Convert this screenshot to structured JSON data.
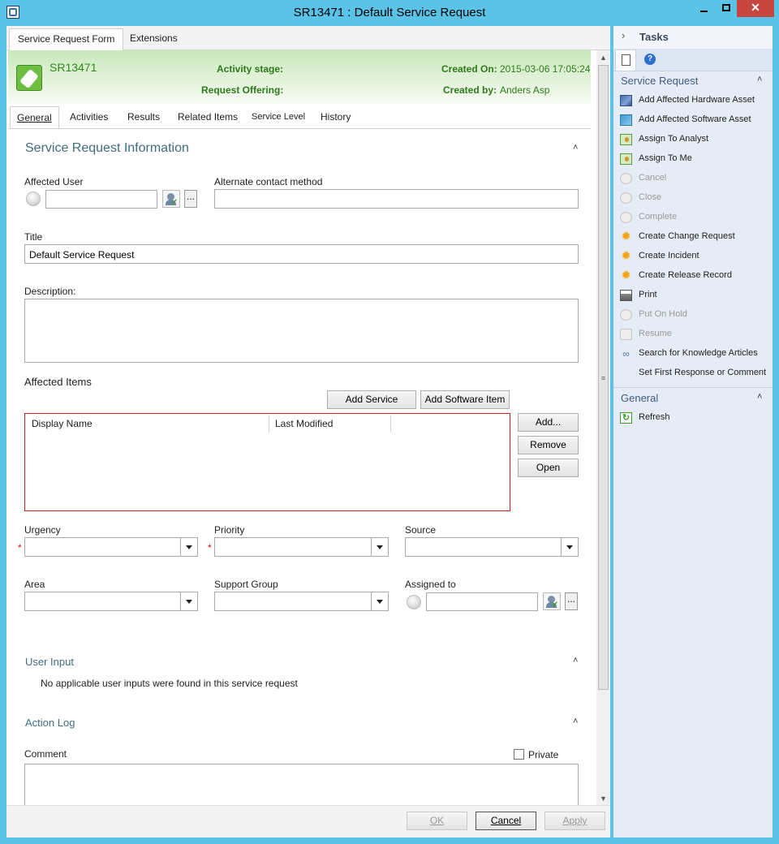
{
  "window": {
    "title": "SR13471 : Default Service Request",
    "close_glyph": "✕"
  },
  "form_tabs": [
    "Service Request Form",
    "Extensions"
  ],
  "header": {
    "id": "SR13471",
    "activity_stage_label": "Activity stage:",
    "activity_stage_value": "",
    "request_offering_label": "Request Offering:",
    "request_offering_value": "",
    "created_on_label": "Created On:",
    "created_on_value": "2015-03-06 17:05:24",
    "created_by_label": "Created by:",
    "created_by_value": "Anders Asp"
  },
  "content_tabs": [
    "General",
    "Activities",
    "Results",
    "Related Items",
    "Service Level",
    "History"
  ],
  "service_request_info": {
    "title": "Service Request Information",
    "affected_user_label": "Affected User",
    "affected_user_value": "",
    "browse_label": "...",
    "alt_contact_label": "Alternate contact method",
    "alt_contact_value": "",
    "title_label": "Title",
    "title_value": "Default Service Request",
    "description_label": "Description:",
    "description_value": ""
  },
  "affected_items": {
    "title": "Affected Items",
    "add_service_label": "Add Service",
    "add_software_label": "Add Software Item",
    "columns": [
      "Display Name",
      "Last Modified"
    ],
    "rows": [],
    "add_label": "Add...",
    "remove_label": "Remove",
    "open_label": "Open"
  },
  "fields": {
    "urgency_label": "Urgency",
    "urgency_value": "",
    "priority_label": "Priority",
    "priority_value": "",
    "source_label": "Source",
    "source_value": "",
    "area_label": "Area",
    "area_value": "",
    "support_group_label": "Support Group",
    "support_group_value": "",
    "assigned_to_label": "Assigned to",
    "assigned_to_value": "",
    "browse_label": "...",
    "required_marker": "*"
  },
  "user_input": {
    "title": "User Input",
    "message": "No applicable user inputs were found in this service request"
  },
  "action_log": {
    "title": "Action Log",
    "comment_label": "Comment",
    "comment_value": "",
    "private_label": "Private",
    "private_checked": false
  },
  "footer": {
    "ok_label": "OK",
    "cancel_label": "Cancel",
    "apply_label": "Apply"
  },
  "tasks": {
    "title": "Tasks",
    "groups": [
      {
        "name": "Service Request",
        "items": [
          {
            "label": "Add Affected Hardware Asset",
            "icon": "hardware-icon",
            "enabled": true
          },
          {
            "label": "Add Affected Software Asset",
            "icon": "software-icon",
            "enabled": true
          },
          {
            "label": "Assign To Analyst",
            "icon": "assign-icon",
            "enabled": true
          },
          {
            "label": "Assign To Me",
            "icon": "assign-icon",
            "enabled": true
          },
          {
            "label": "Cancel",
            "icon": "cancel-icon",
            "enabled": false
          },
          {
            "label": "Close",
            "icon": "close-icon",
            "enabled": false
          },
          {
            "label": "Complete",
            "icon": "complete-icon",
            "enabled": false
          },
          {
            "label": "Create Change Request",
            "icon": "star-icon",
            "enabled": true
          },
          {
            "label": "Create Incident",
            "icon": "star-icon",
            "enabled": true
          },
          {
            "label": "Create Release Record",
            "icon": "star-icon",
            "enabled": true
          },
          {
            "label": "Print",
            "icon": "printer-icon",
            "enabled": true
          },
          {
            "label": "Put On Hold",
            "icon": "hold-icon",
            "enabled": false
          },
          {
            "label": "Resume",
            "icon": "resume-icon",
            "enabled": false
          },
          {
            "label": "Search for Knowledge Articles",
            "icon": "search-icon",
            "enabled": true
          },
          {
            "label": "Set First Response or Comment",
            "icon": "",
            "enabled": true
          }
        ]
      },
      {
        "name": "General",
        "items": [
          {
            "label": "Refresh",
            "icon": "refresh-icon",
            "enabled": true
          }
        ]
      }
    ]
  },
  "colors": {
    "title_bar": "#5bc3e8",
    "header_green": "#2e7a1a",
    "section_title": "#3f6d7e",
    "grid_border": "#d02020",
    "tasks_bg": "#e6ecf5"
  }
}
